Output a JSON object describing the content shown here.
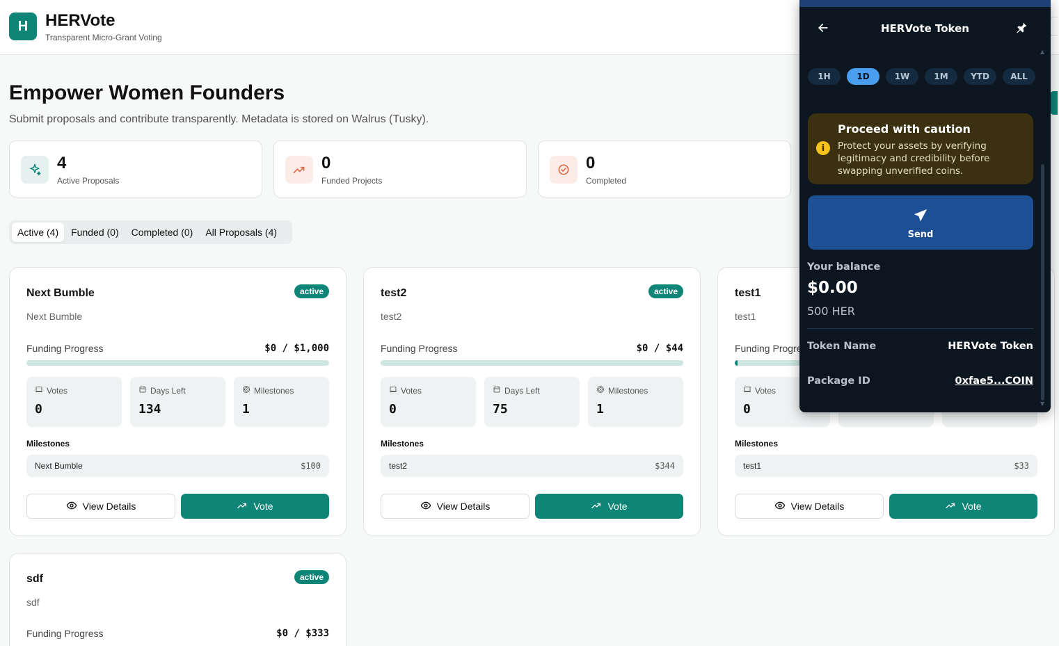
{
  "header": {
    "logo_letter": "H",
    "title": "HERVote",
    "subtitle": "Transparent Micro-Grant Voting"
  },
  "hero": {
    "title": "Empower Women Founders",
    "subtitle": "Submit proposals and contribute transparently. Metadata is stored on Walrus (Tusky)."
  },
  "stats": [
    {
      "value": "4",
      "label": "Active Proposals",
      "icon": "sparkle-icon"
    },
    {
      "value": "0",
      "label": "Funded Projects",
      "icon": "trending-up-icon"
    },
    {
      "value": "0",
      "label": "Completed",
      "icon": "check-circle-icon"
    }
  ],
  "tabs": [
    "Active (4)",
    "Funded (0)",
    "Completed (0)",
    "All Proposals (4)"
  ],
  "card_labels": {
    "funding_progress": "Funding Progress",
    "votes": "Votes",
    "days_left": "Days Left",
    "milestones": "Milestones",
    "milestones_heading": "Milestones",
    "view_details": "View Details",
    "vote": "Vote"
  },
  "proposals": [
    {
      "title": "Next Bumble",
      "status": "active",
      "description": "Next Bumble",
      "funding": "$0 / $1,000",
      "progress": 0,
      "votes": "0",
      "days_left": "134",
      "milestones": "1",
      "milestone_name": "Next Bumble",
      "milestone_amount": "$100"
    },
    {
      "title": "test2",
      "status": "active",
      "description": "test2",
      "funding": "$0 / $44",
      "progress": 0,
      "votes": "0",
      "days_left": "75",
      "milestones": "1",
      "milestone_name": "test2",
      "milestone_amount": "$344"
    },
    {
      "title": "test1",
      "status": "",
      "description": "test1",
      "funding": "",
      "progress": 0.01,
      "votes": "0",
      "days_left": "",
      "milestones": "",
      "milestone_name": "test1",
      "milestone_amount": "$33"
    },
    {
      "title": "sdf",
      "status": "active",
      "description": "sdf",
      "funding": "$0 / $333",
      "progress": 0
    }
  ],
  "wallet": {
    "title": "HERVote Token",
    "ranges": [
      "1H",
      "1D",
      "1W",
      "1M",
      "YTD",
      "ALL"
    ],
    "selected_range": "1D",
    "caution_title": "Proceed with caution",
    "caution_text": "Protect your assets by verifying legitimacy and credibility before swapping unverified coins.",
    "send_label": "Send",
    "balance_label": "Your balance",
    "balance_usd": "$0.00",
    "balance_token": "500 HER",
    "token_name_label": "Token Name",
    "token_name_value": "HERVote Token",
    "package_id_label": "Package ID",
    "package_id_value": "0xfae5...COIN"
  },
  "colors": {
    "accent": "#0e8577",
    "wallet_bg": "#0b1620",
    "caution_bg": "#3b3110",
    "send_bg": "#1c4f94",
    "range_selected": "#4a9ef0"
  }
}
